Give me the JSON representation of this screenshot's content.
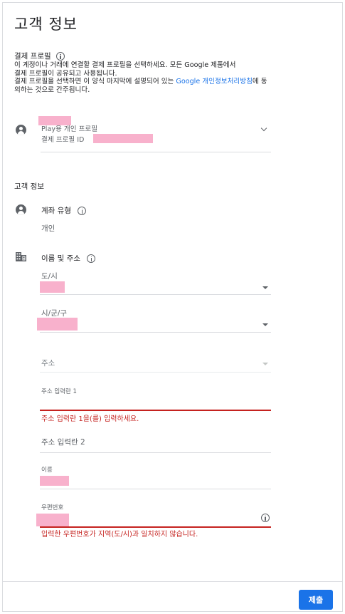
{
  "page": {
    "title": "고객 정보"
  },
  "payment_profile": {
    "label": "결제 프로필",
    "desc_line1": "이 계정이나 거래에 연결할 결제 프로필을 선택하세요. 모든 Google 제품에서",
    "desc_line2": "결제 프로필이 공유되고 사용됩니다.",
    "desc_line3_pre": "결제 프로필을 선택하면 이 양식 마지막에 설명되어 있는 ",
    "desc_link": "Google 개인정보처리방침",
    "desc_line3_post": "에 동의하는 것으로 간주됩니다.",
    "profile_type": "Play용 개인 프로필",
    "profile_id_label": "결제 프로필 ID"
  },
  "customer_info": {
    "heading": "고객 정보",
    "account_type_label": "계좌 유형",
    "account_type_value": "개인",
    "name_address_label": "이름 및 주소"
  },
  "fields": {
    "province_label": "도/시",
    "city_label": "시/군/구",
    "address_label": "주소",
    "address1_label": "주소 입력란 1",
    "address1_error": "주소 입력란 1을(를) 입력하세요.",
    "address2_placeholder": "주소 입력란 2",
    "name_label": "이름",
    "postal_label": "우편번호",
    "postal_error": "입력한 우편번호가 지역(도/시)과 일치하지 않습니다."
  },
  "footer": {
    "submit_label": "제출"
  }
}
